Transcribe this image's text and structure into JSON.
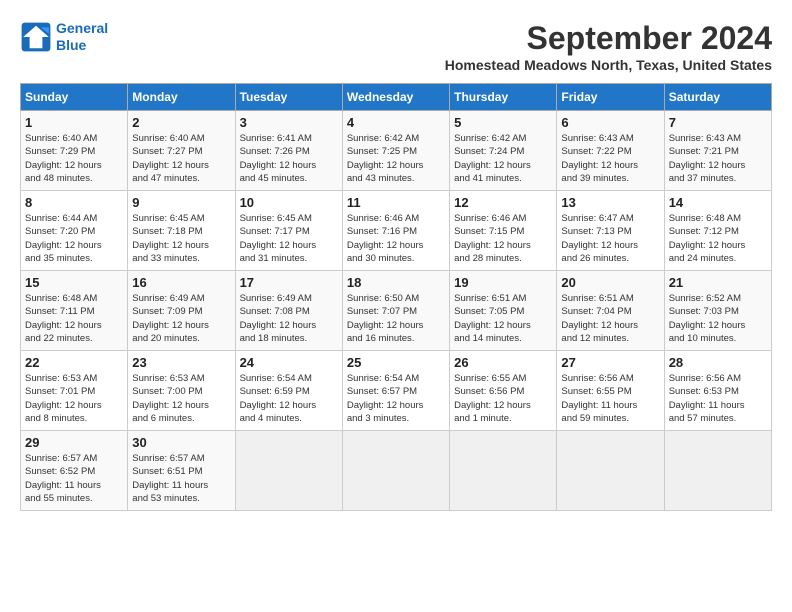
{
  "logo": {
    "line1": "General",
    "line2": "Blue"
  },
  "title": "September 2024",
  "subtitle": "Homestead Meadows North, Texas, United States",
  "days_of_week": [
    "Sunday",
    "Monday",
    "Tuesday",
    "Wednesday",
    "Thursday",
    "Friday",
    "Saturday"
  ],
  "weeks": [
    [
      {
        "num": "1",
        "detail": "Sunrise: 6:40 AM\nSunset: 7:29 PM\nDaylight: 12 hours\nand 48 minutes."
      },
      {
        "num": "2",
        "detail": "Sunrise: 6:40 AM\nSunset: 7:27 PM\nDaylight: 12 hours\nand 47 minutes."
      },
      {
        "num": "3",
        "detail": "Sunrise: 6:41 AM\nSunset: 7:26 PM\nDaylight: 12 hours\nand 45 minutes."
      },
      {
        "num": "4",
        "detail": "Sunrise: 6:42 AM\nSunset: 7:25 PM\nDaylight: 12 hours\nand 43 minutes."
      },
      {
        "num": "5",
        "detail": "Sunrise: 6:42 AM\nSunset: 7:24 PM\nDaylight: 12 hours\nand 41 minutes."
      },
      {
        "num": "6",
        "detail": "Sunrise: 6:43 AM\nSunset: 7:22 PM\nDaylight: 12 hours\nand 39 minutes."
      },
      {
        "num": "7",
        "detail": "Sunrise: 6:43 AM\nSunset: 7:21 PM\nDaylight: 12 hours\nand 37 minutes."
      }
    ],
    [
      {
        "num": "8",
        "detail": "Sunrise: 6:44 AM\nSunset: 7:20 PM\nDaylight: 12 hours\nand 35 minutes."
      },
      {
        "num": "9",
        "detail": "Sunrise: 6:45 AM\nSunset: 7:18 PM\nDaylight: 12 hours\nand 33 minutes."
      },
      {
        "num": "10",
        "detail": "Sunrise: 6:45 AM\nSunset: 7:17 PM\nDaylight: 12 hours\nand 31 minutes."
      },
      {
        "num": "11",
        "detail": "Sunrise: 6:46 AM\nSunset: 7:16 PM\nDaylight: 12 hours\nand 30 minutes."
      },
      {
        "num": "12",
        "detail": "Sunrise: 6:46 AM\nSunset: 7:15 PM\nDaylight: 12 hours\nand 28 minutes."
      },
      {
        "num": "13",
        "detail": "Sunrise: 6:47 AM\nSunset: 7:13 PM\nDaylight: 12 hours\nand 26 minutes."
      },
      {
        "num": "14",
        "detail": "Sunrise: 6:48 AM\nSunset: 7:12 PM\nDaylight: 12 hours\nand 24 minutes."
      }
    ],
    [
      {
        "num": "15",
        "detail": "Sunrise: 6:48 AM\nSunset: 7:11 PM\nDaylight: 12 hours\nand 22 minutes."
      },
      {
        "num": "16",
        "detail": "Sunrise: 6:49 AM\nSunset: 7:09 PM\nDaylight: 12 hours\nand 20 minutes."
      },
      {
        "num": "17",
        "detail": "Sunrise: 6:49 AM\nSunset: 7:08 PM\nDaylight: 12 hours\nand 18 minutes."
      },
      {
        "num": "18",
        "detail": "Sunrise: 6:50 AM\nSunset: 7:07 PM\nDaylight: 12 hours\nand 16 minutes."
      },
      {
        "num": "19",
        "detail": "Sunrise: 6:51 AM\nSunset: 7:05 PM\nDaylight: 12 hours\nand 14 minutes."
      },
      {
        "num": "20",
        "detail": "Sunrise: 6:51 AM\nSunset: 7:04 PM\nDaylight: 12 hours\nand 12 minutes."
      },
      {
        "num": "21",
        "detail": "Sunrise: 6:52 AM\nSunset: 7:03 PM\nDaylight: 12 hours\nand 10 minutes."
      }
    ],
    [
      {
        "num": "22",
        "detail": "Sunrise: 6:53 AM\nSunset: 7:01 PM\nDaylight: 12 hours\nand 8 minutes."
      },
      {
        "num": "23",
        "detail": "Sunrise: 6:53 AM\nSunset: 7:00 PM\nDaylight: 12 hours\nand 6 minutes."
      },
      {
        "num": "24",
        "detail": "Sunrise: 6:54 AM\nSunset: 6:59 PM\nDaylight: 12 hours\nand 4 minutes."
      },
      {
        "num": "25",
        "detail": "Sunrise: 6:54 AM\nSunset: 6:57 PM\nDaylight: 12 hours\nand 3 minutes."
      },
      {
        "num": "26",
        "detail": "Sunrise: 6:55 AM\nSunset: 6:56 PM\nDaylight: 12 hours\nand 1 minute."
      },
      {
        "num": "27",
        "detail": "Sunrise: 6:56 AM\nSunset: 6:55 PM\nDaylight: 11 hours\nand 59 minutes."
      },
      {
        "num": "28",
        "detail": "Sunrise: 6:56 AM\nSunset: 6:53 PM\nDaylight: 11 hours\nand 57 minutes."
      }
    ],
    [
      {
        "num": "29",
        "detail": "Sunrise: 6:57 AM\nSunset: 6:52 PM\nDaylight: 11 hours\nand 55 minutes."
      },
      {
        "num": "30",
        "detail": "Sunrise: 6:57 AM\nSunset: 6:51 PM\nDaylight: 11 hours\nand 53 minutes."
      },
      {
        "num": "",
        "detail": ""
      },
      {
        "num": "",
        "detail": ""
      },
      {
        "num": "",
        "detail": ""
      },
      {
        "num": "",
        "detail": ""
      },
      {
        "num": "",
        "detail": ""
      }
    ]
  ]
}
